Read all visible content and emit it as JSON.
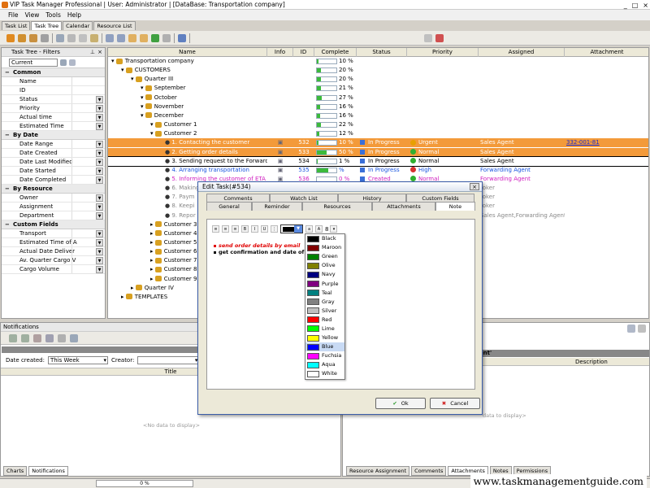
{
  "window": {
    "title": "VIP Task Manager Professional | User: Administrator | [DataBase: Transportation company]"
  },
  "menu": [
    "File",
    "View",
    "Tools",
    "Help"
  ],
  "view_tabs": [
    "Task List",
    "Task Tree",
    "Calendar",
    "Resource List"
  ],
  "filters": {
    "title": "Task Tree - Filters",
    "current": "Current",
    "groups": [
      {
        "name": "Common",
        "items": [
          "Name",
          "ID",
          "Status",
          "Priority",
          "Actual time",
          "Estimated Time"
        ]
      },
      {
        "name": "By Date",
        "items": [
          "Date Range",
          "Date Created",
          "Date Last Modified",
          "Date Started",
          "Date Completed"
        ]
      },
      {
        "name": "By Resource",
        "items": [
          "Owner",
          "Assignment",
          "Department"
        ]
      },
      {
        "name": "Custom Fields",
        "items": [
          "Transport",
          "Estimated Time of A",
          "Actual Date Deliver",
          "Av. Quarter Cargo V",
          "Cargo Volume"
        ]
      }
    ]
  },
  "grid": {
    "columns": [
      "Name",
      "Info",
      "ID",
      "Complete",
      "Status",
      "Priority",
      "Assigned",
      "Attachment"
    ],
    "rows": [
      {
        "name": "Transportation company",
        "indent": 0,
        "complete": "10 %",
        "pct": 10
      },
      {
        "name": "CUSTOMERS",
        "indent": 1,
        "complete": "20 %",
        "pct": 20
      },
      {
        "name": "Quarter III",
        "indent": 2,
        "complete": "20 %",
        "pct": 20
      },
      {
        "name": "September",
        "indent": 3,
        "complete": "21 %",
        "pct": 21
      },
      {
        "name": "October",
        "indent": 3,
        "complete": "27 %",
        "pct": 27
      },
      {
        "name": "November",
        "indent": 3,
        "complete": "16 %",
        "pct": 16
      },
      {
        "name": "December",
        "indent": 3,
        "complete": "16 %",
        "pct": 16
      },
      {
        "name": "Customer 1",
        "indent": 4,
        "complete": "22 %",
        "pct": 22
      },
      {
        "name": "Customer 2",
        "indent": 4,
        "complete": "12 %",
        "pct": 12
      },
      {
        "name": "1. Contacting the customer",
        "indent": 5,
        "id": "532",
        "complete": "10 %",
        "pct": 10,
        "status": "In Progress",
        "priority": "Urgent",
        "assigned": "Sales Agent",
        "attachment": "332-001-81",
        "style": "orange",
        "prio_color": "#e8a000"
      },
      {
        "name": "2. Getting order details",
        "indent": 5,
        "id": "533",
        "complete": "50 %",
        "pct": 50,
        "status": "In Progress",
        "priority": "Normal",
        "assigned": "Sales Agent",
        "style": "orange",
        "prio_color": "#30b030"
      },
      {
        "name": "3. Sending request to the Forwarding",
        "indent": 5,
        "id": "534",
        "complete": "1 %",
        "pct": 1,
        "status": "In Progress",
        "priority": "Normal",
        "assigned": "Sales Agent",
        "style": "sel",
        "prio_color": "#30b030"
      },
      {
        "name": "4. Arranging transportation",
        "indent": 5,
        "id": "535",
        "complete": "%",
        "pct": 60,
        "status": "In Progress",
        "priority": "High",
        "assigned": "Forwarding Agent",
        "style": "blue",
        "prio_color": "#d83030"
      },
      {
        "name": "5. Informing the customer of ETA and",
        "indent": 5,
        "id": "536",
        "complete": "0 %",
        "pct": 0,
        "status": "Created",
        "priority": "Normal",
        "assigned": "Forwarding Agent",
        "style": "magenta",
        "prio_color": "#30b030"
      },
      {
        "name": "6. Making",
        "indent": 5,
        "assigned": "roker",
        "style": "gray"
      },
      {
        "name": "7. Paym",
        "indent": 5,
        "assigned": "roker",
        "style": "gray"
      },
      {
        "name": "8. Keepi",
        "indent": 5,
        "assigned": "roker",
        "style": "gray"
      },
      {
        "name": "9. Repor",
        "indent": 5,
        "assigned": "Sales Agent,Forwarding Agent,Bro",
        "style": "gray"
      },
      {
        "name": "Customer 3",
        "indent": 4
      },
      {
        "name": "Customer 4",
        "indent": 4
      },
      {
        "name": "Customer 5",
        "indent": 4
      },
      {
        "name": "Customer 6",
        "indent": 4
      },
      {
        "name": "Customer 7",
        "indent": 4
      },
      {
        "name": "Customer 8",
        "indent": 4
      },
      {
        "name": "Customer 9",
        "indent": 4
      },
      {
        "name": "Quarter IV",
        "indent": 2
      },
      {
        "name": "TEMPLATES",
        "indent": 1
      }
    ]
  },
  "notifications": {
    "title": "Notifications",
    "date_label": "Date created:",
    "date_value": "This Week",
    "creator_label": "Creator:",
    "col_title": "Title",
    "no_data": "<No data to display>",
    "tabs": [
      "Charts",
      "Notifications"
    ]
  },
  "right_panel": {
    "header": "g Agent'",
    "col_description": "Description",
    "no_data": "data to display>",
    "tabs": [
      "Resource Assignment",
      "Comments",
      "Attachments",
      "Notes",
      "Permissions"
    ]
  },
  "status": {
    "progress": "0 %"
  },
  "watermark": "www.taskmanagementguide.com",
  "dialog": {
    "title": "Edit Task(#534)",
    "tabs_row1": [
      "Comments",
      "Watch List",
      "History",
      "Custom Fields"
    ],
    "tabs_row2": [
      "General",
      "Reminder",
      "Resources",
      "Attachments",
      "Note"
    ],
    "font_size": "8",
    "note_lines": [
      "send order details by email",
      "get confirmation and date of dep"
    ],
    "ok": "Ok",
    "cancel": "Cancel"
  },
  "colors": [
    {
      "name": "Black",
      "hex": "#000000"
    },
    {
      "name": "Maroon",
      "hex": "#800000"
    },
    {
      "name": "Green",
      "hex": "#008000"
    },
    {
      "name": "Olive",
      "hex": "#808000"
    },
    {
      "name": "Navy",
      "hex": "#000080"
    },
    {
      "name": "Purple",
      "hex": "#800080"
    },
    {
      "name": "Teal",
      "hex": "#008080"
    },
    {
      "name": "Gray",
      "hex": "#808080"
    },
    {
      "name": "Silver",
      "hex": "#c0c0c0"
    },
    {
      "name": "Red",
      "hex": "#ff0000"
    },
    {
      "name": "Lime",
      "hex": "#00ff00"
    },
    {
      "name": "Yellow",
      "hex": "#ffff00"
    },
    {
      "name": "Blue",
      "hex": "#0000ff"
    },
    {
      "name": "Fuchsia",
      "hex": "#ff00ff"
    },
    {
      "name": "Aqua",
      "hex": "#00ffff"
    },
    {
      "name": "White",
      "hex": "#ffffff"
    }
  ],
  "selected_color": "Blue"
}
